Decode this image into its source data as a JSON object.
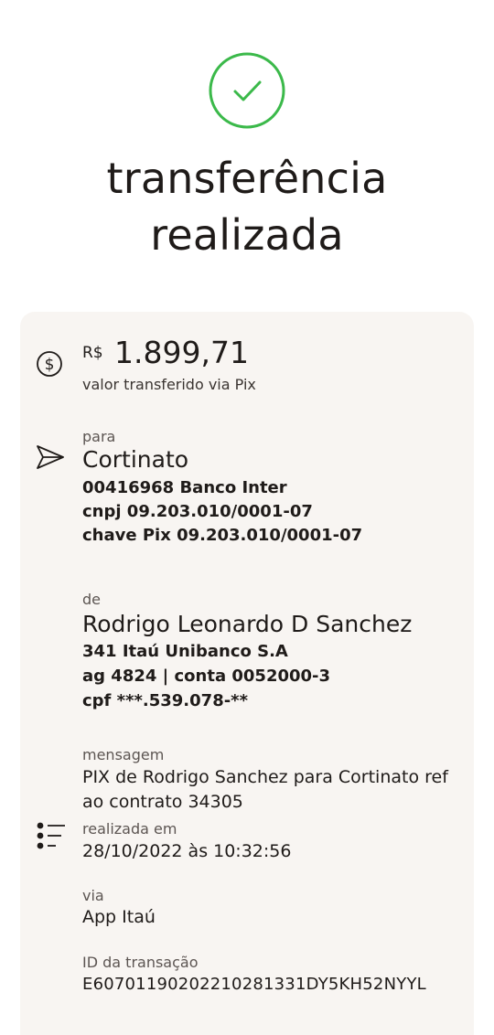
{
  "header": {
    "title_line1": "transferência",
    "title_line2": "realizada",
    "success_color": "#3bb94a"
  },
  "amount": {
    "currency": "R$",
    "value": "1.899,71",
    "caption": "valor transferido via Pix"
  },
  "recipient": {
    "label": "para",
    "name": "Cortinato",
    "bank": "00416968 Banco Inter",
    "document": "cnpj 09.203.010/0001-07",
    "pix_key": "chave Pix 09.203.010/0001-07"
  },
  "sender": {
    "label": "de",
    "name": "Rodrigo Leonardo D Sanchez",
    "bank": "341 Itaú Unibanco S.A",
    "account": "ag 4824 | conta 0052000-3",
    "document": "cpf ***.539.078-**"
  },
  "details": {
    "message_label": "mensagem",
    "message_line1": "PIX de Rodrigo Sanchez para Cortinato ref",
    "message_line2": "ao contrato 34305",
    "date_label": "realizada em",
    "date_value": "28/10/2022 às 10:32:56",
    "via_label": "via",
    "via_value": "App Itaú",
    "id_label": "ID da transação",
    "id_value": "E60701190202210281331DY5KH52NYYL"
  },
  "icons": {
    "success": "check-circle-icon",
    "amount": "dollar-circle-icon",
    "recipient": "send-icon",
    "details": "list-icon"
  }
}
